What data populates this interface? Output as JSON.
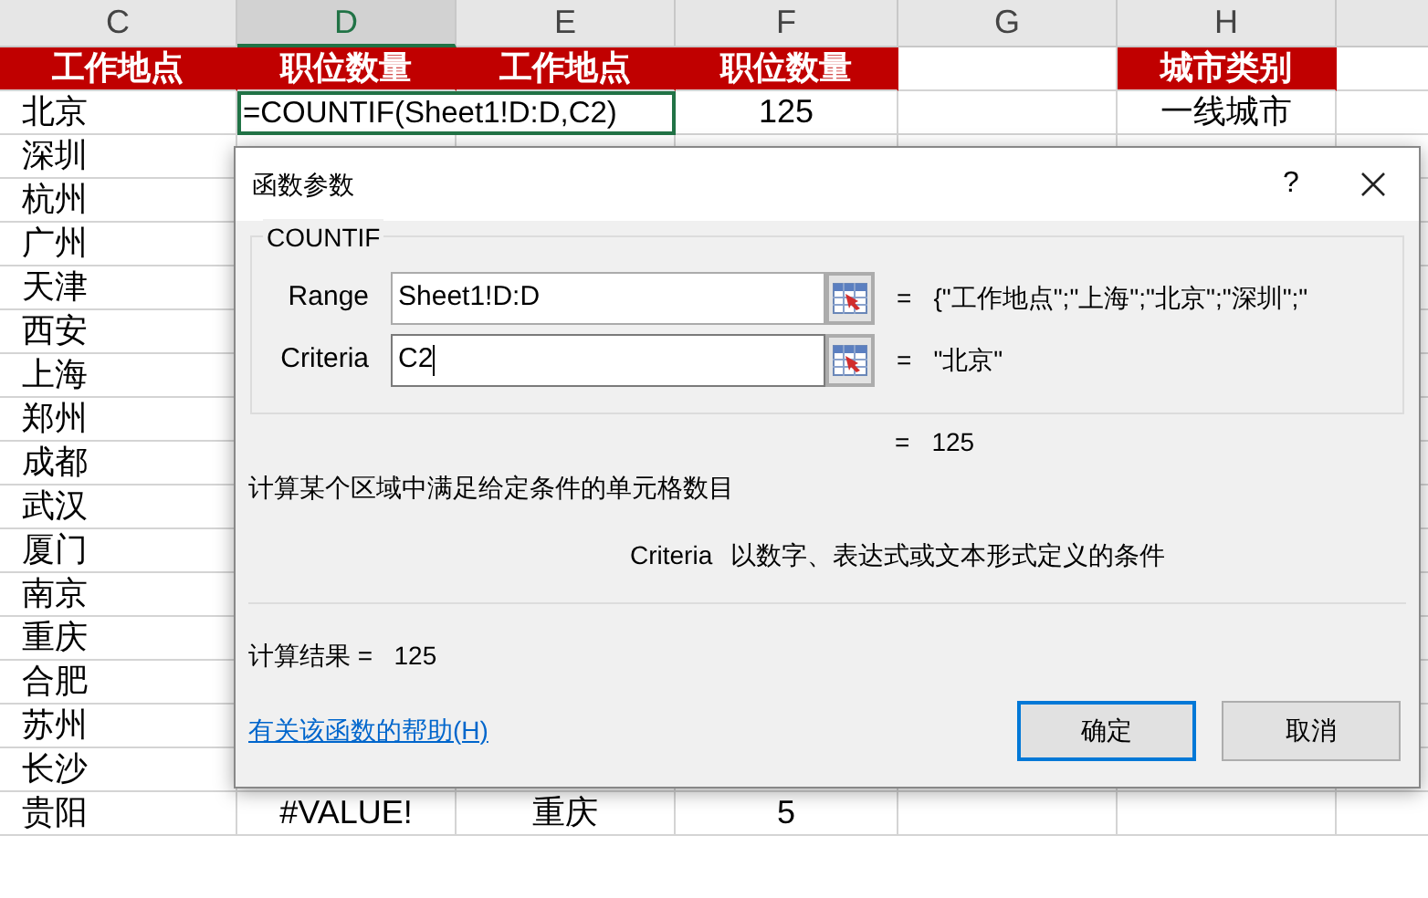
{
  "sheet": {
    "columns": [
      {
        "label": "C",
        "selected": false
      },
      {
        "label": "D",
        "selected": true
      },
      {
        "label": "E",
        "selected": false
      },
      {
        "label": "F",
        "selected": false
      },
      {
        "label": "G",
        "selected": false
      },
      {
        "label": "H",
        "selected": false
      }
    ],
    "rows": [
      {
        "kind": "header",
        "cells": [
          "工作地点",
          "职位数量",
          "工作地点",
          "职位数量",
          null,
          "城市类别"
        ]
      },
      {
        "kind": "data",
        "cells": [
          {
            "text": "北京",
            "active": false
          },
          {
            "text": "=COUNTIF(Sheet1!D:D,C2)",
            "active": true
          },
          null,
          {
            "text": "125",
            "active": false
          },
          {
            "active": false
          },
          {
            "text": "一线城市",
            "active": false
          }
        ]
      },
      {
        "kind": "data",
        "cells": [
          "深圳"
        ]
      },
      {
        "kind": "data",
        "cells": [
          "杭州"
        ]
      },
      {
        "kind": "data",
        "cells": [
          "广州"
        ]
      },
      {
        "kind": "data",
        "cells": [
          "天津"
        ]
      },
      {
        "kind": "data",
        "cells": [
          "西安"
        ]
      },
      {
        "kind": "data",
        "cells": [
          "上海"
        ]
      },
      {
        "kind": "data",
        "cells": [
          "郑州"
        ]
      },
      {
        "kind": "data",
        "cells": [
          "成都"
        ]
      },
      {
        "kind": "data",
        "cells": [
          "武汉"
        ]
      },
      {
        "kind": "data",
        "cells": [
          "厦门"
        ]
      },
      {
        "kind": "data",
        "cells": [
          "南京"
        ]
      },
      {
        "kind": "data",
        "cells": [
          "重庆"
        ]
      },
      {
        "kind": "data",
        "cells": [
          "合肥"
        ]
      },
      {
        "kind": "data",
        "cells": [
          "苏州"
        ]
      },
      {
        "kind": "data",
        "cells": [
          "长沙"
        ]
      },
      {
        "kind": "data",
        "cells": [
          "贵阳",
          "#VALUE!",
          "重庆",
          "5"
        ]
      }
    ]
  },
  "dialog": {
    "title": "函数参数",
    "help_button": "?",
    "function_name": "COUNTIF",
    "arguments": [
      {
        "label": "Range",
        "value": "Sheet1!D:D",
        "focused": false,
        "equals": "=",
        "result": "{\"工作地点\";\"上海\";\"北京\";\"深圳\";\""
      },
      {
        "label": "Criteria",
        "value": "C2",
        "focused": true,
        "equals": "=",
        "result": "\"北京\""
      }
    ],
    "formula_equals": "=",
    "formula_result": "125",
    "description": "计算某个区域中满足给定条件的单元格数目",
    "argument_help": {
      "name": "Criteria",
      "text": "以数字、表达式或文本形式定义的条件"
    },
    "result_label": "计算结果 =",
    "result_value": "125",
    "help_link": "有关该函数的帮助(H)",
    "buttons": [
      {
        "label": "确定",
        "default": true
      },
      {
        "label": "取消",
        "default": false
      }
    ]
  }
}
